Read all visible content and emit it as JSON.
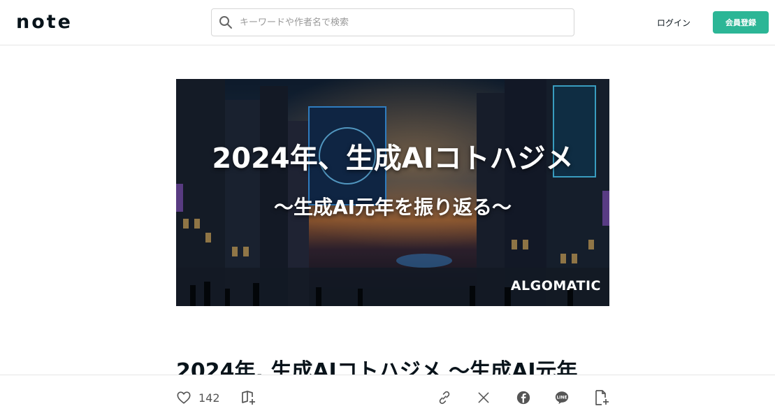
{
  "header": {
    "logo": "note",
    "search_placeholder": "キーワードや作者名で検索",
    "login_label": "ログイン",
    "signup_label": "会員登録"
  },
  "hero": {
    "title": "2024年、生成AIコトハジメ",
    "subtitle": "〜生成AI元年を振り返る〜",
    "brand": "ALGOMATIC"
  },
  "article": {
    "title": "2024年, 生成AIコトハジメ 〜生成AI元年"
  },
  "actions": {
    "like_count": "142",
    "icons": [
      "heart-icon",
      "magazine-add-icon",
      "link-icon",
      "x-icon",
      "facebook-icon",
      "line-icon",
      "note-add-icon"
    ]
  },
  "colors": {
    "accent": "#2cb696",
    "text": "#08131a",
    "icon_gray": "#555555"
  }
}
